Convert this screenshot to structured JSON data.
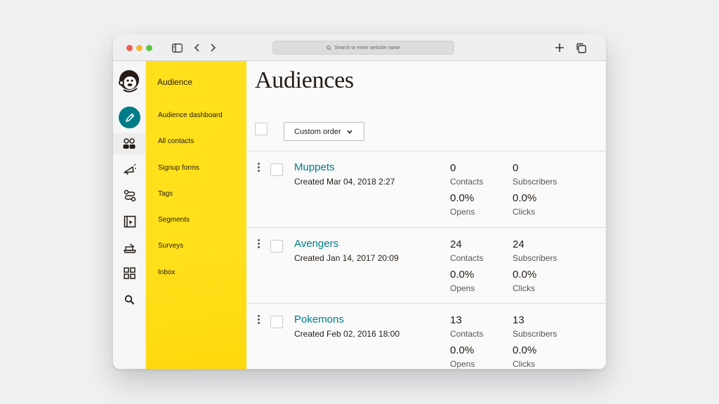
{
  "browser": {
    "search_placeholder": "Search or enter website name"
  },
  "rail": {
    "items": [
      {
        "icon": "mailchimp-logo"
      },
      {
        "icon": "pencil-icon"
      },
      {
        "icon": "audience-icon"
      },
      {
        "icon": "campaign-icon"
      },
      {
        "icon": "automation-icon"
      },
      {
        "icon": "website-icon"
      },
      {
        "icon": "integrations-icon"
      },
      {
        "icon": "grid-icon"
      },
      {
        "icon": "search-icon"
      }
    ]
  },
  "sidebar": {
    "title": "Audience",
    "items": [
      {
        "label": "Audience dashboard"
      },
      {
        "label": "All contacts"
      },
      {
        "label": "Signup forms"
      },
      {
        "label": "Tags"
      },
      {
        "label": "Segments"
      },
      {
        "label": "Surveys"
      },
      {
        "label": "Inbox"
      }
    ]
  },
  "main": {
    "title": "Audiences",
    "sort_label": "Custom order",
    "audiences": [
      {
        "name": "Muppets",
        "created": "Created Mar 04, 2018 2:27",
        "contacts": "0",
        "contacts_label": "Contacts",
        "subscribers": "0",
        "subscribers_label": "Subscribers",
        "opens": "0.0%",
        "opens_label": "Opens",
        "clicks": "0.0%",
        "clicks_label": "Clicks"
      },
      {
        "name": "Avengers",
        "created": "Created Jan 14, 2017 20:09",
        "contacts": "24",
        "contacts_label": "Contacts",
        "subscribers": "24",
        "subscribers_label": "Subscribers",
        "opens": "0.0%",
        "opens_label": "Opens",
        "clicks": "0.0%",
        "clicks_label": "Clicks"
      },
      {
        "name": "Pokemons",
        "created": "Created Feb 02, 2016 18:00",
        "contacts": "13",
        "contacts_label": "Contacts",
        "subscribers": "13",
        "subscribers_label": "Subscribers",
        "opens": "0.0%",
        "opens_label": "Opens",
        "clicks": "0.0%",
        "clicks_label": "Clicks"
      }
    ]
  },
  "colors": {
    "accent_yellow": "#ffe01b",
    "link_teal": "#007c89",
    "pencil_button": "#007c89"
  }
}
